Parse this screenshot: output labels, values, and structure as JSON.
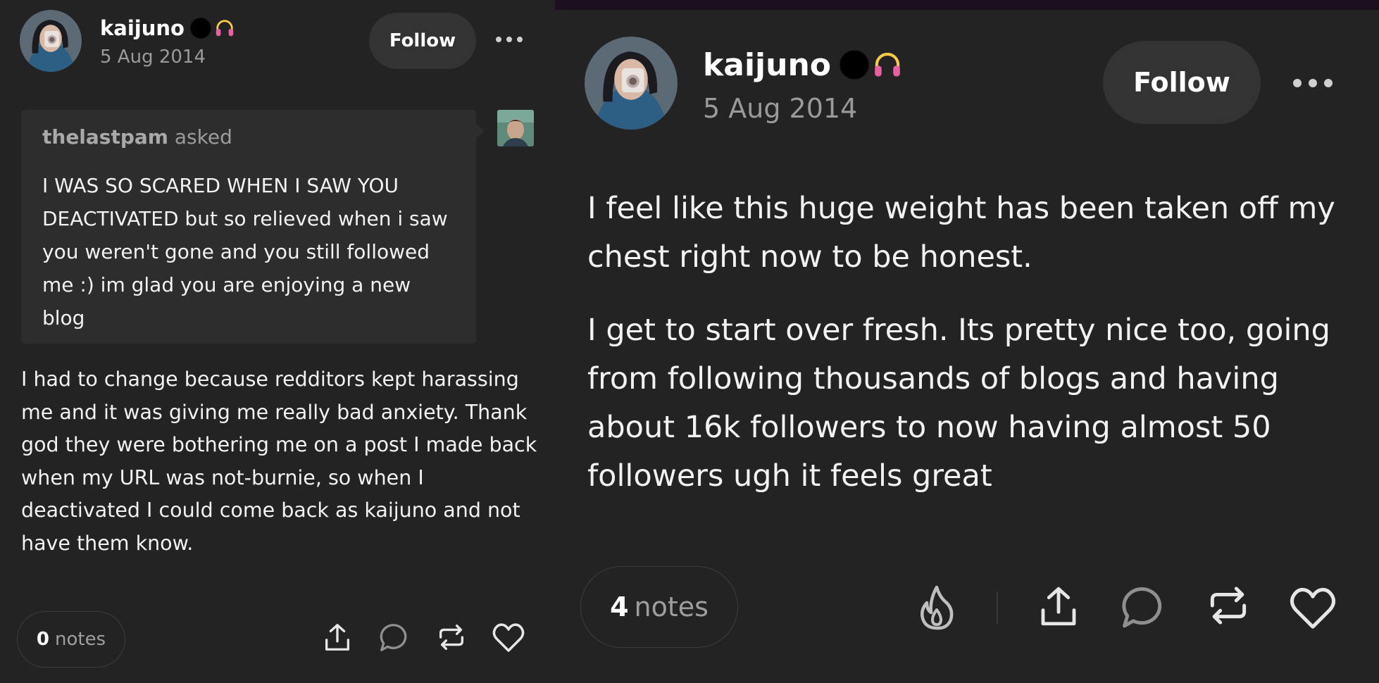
{
  "left_post": {
    "username": "kaijuno",
    "date": "5 Aug 2014",
    "follow_label": "Follow",
    "ask": {
      "asker": "thelastpam",
      "asked_word": "asked",
      "question": "I WAS SO SCARED WHEN I SAW YOU DEACTIVATED but so relieved when i saw you weren't gone and you still followed me :) im glad you are enjoying a new blog"
    },
    "answer": "I had to change because redditors kept harassing me and it was giving me really bad anxiety. Thank god they were bothering me on a post I made back when my URL was not-burnie, so when I deactivated I could come back as kaijuno and not have them know.",
    "notes_count": "0",
    "notes_label": "notes",
    "actions": [
      "share-icon",
      "reply-icon",
      "reblog-icon",
      "like-icon"
    ]
  },
  "right_post": {
    "username": "kaijuno",
    "date": "5 Aug 2014",
    "follow_label": "Follow",
    "paragraphs": [
      "I feel like this huge weight has been taken off my chest right now to be honest.",
      "I get to start over fresh. Its pretty nice too, going from following thousands of blogs and having about 16k followers to now having almost 50 followers ugh it feels great"
    ],
    "notes_count": "4",
    "notes_label": "notes",
    "actions": [
      "blaze-icon",
      "share-icon",
      "reply-icon",
      "reblog-icon",
      "like-icon"
    ]
  },
  "colors": {
    "background": "#232323",
    "card": "#2d2d2d",
    "button": "#333333",
    "muted_text": "#9a9a9a",
    "headphones": "#f7c948",
    "top_strip": "#1c0f1f"
  }
}
